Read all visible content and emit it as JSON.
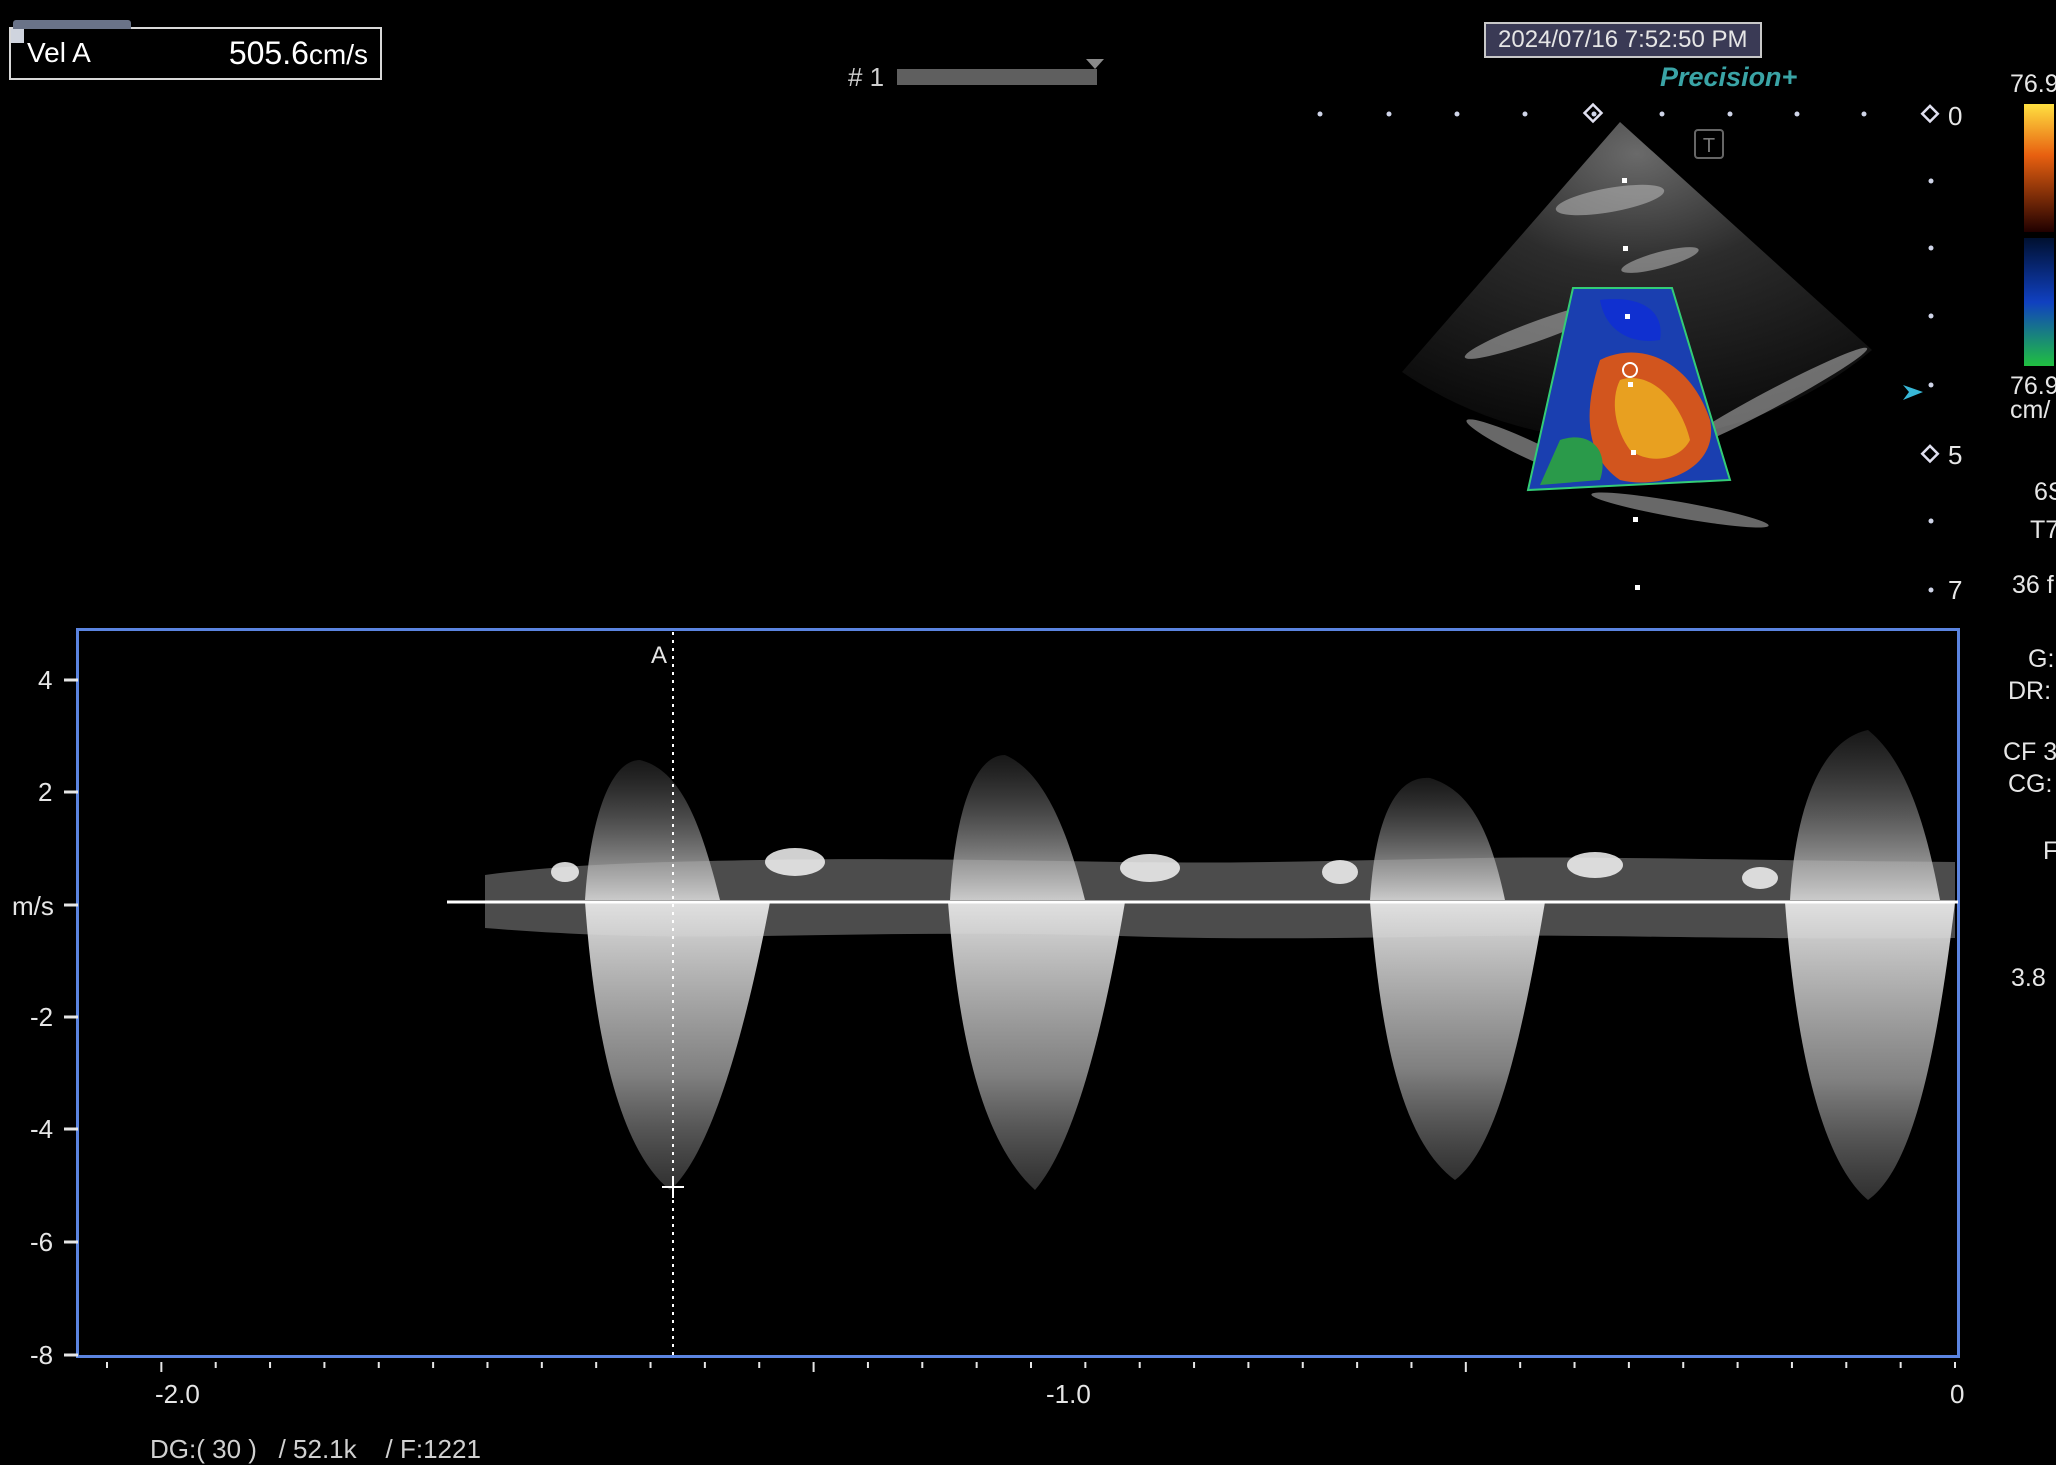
{
  "measurement": {
    "label": "Vel A",
    "value": "505.6",
    "unit": "cm/s"
  },
  "frame": {
    "label": "# 1"
  },
  "datetime": "2024/07/16 7:52:50 PM",
  "brand": "Precision+",
  "depth_scale": {
    "top": "0",
    "mid": "5",
    "bottom": "7"
  },
  "color_velocity": {
    "top": "76.9",
    "bottom": "76.9",
    "unit": "cm/"
  },
  "side_params": [
    "6S",
    "T7",
    "36 f",
    "G:",
    "DR:",
    "CF 3",
    "CG:",
    "F",
    "3.8"
  ],
  "spectral": {
    "cursor_label": "A",
    "y_unit": "m/s",
    "y_ticks": [
      "4",
      "2",
      "-2",
      "-4",
      "-6",
      "-8"
    ],
    "x_ticks": [
      "-2.0",
      "-1.0",
      "0"
    ]
  },
  "bottom_info": "DG:( 30 )   / 52.1k    / F:1221",
  "colors": {
    "panel_border": "#5b84e0",
    "brand": "#3aa4a6",
    "roi": "#33cc77"
  }
}
